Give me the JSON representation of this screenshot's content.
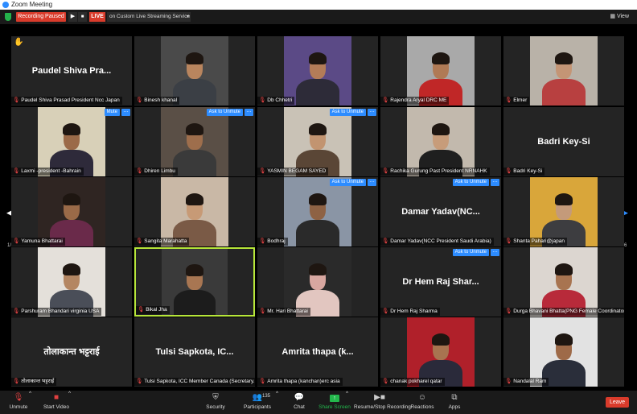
{
  "window": {
    "title": "Zoom Meeting"
  },
  "topbar": {
    "recording_status": "Recording Paused",
    "resume_icon": "▶",
    "stop_icon": "■",
    "live_badge": "LIVE",
    "live_service": "on Custom Live Streaming Service",
    "view_label": "View"
  },
  "gallery": {
    "page_prev_label": "1/6",
    "page_next_label": "1/6",
    "tiles": [
      {
        "name": "Paudel Shiva Prasad President Ncc Japan",
        "big": "Paudel Shiva Pra...",
        "video": false,
        "hand": true
      },
      {
        "name": "Binesh khanal",
        "video": true,
        "bg": "#4a4a4a",
        "shirt": "#3b3f45",
        "skin": "#b9855e"
      },
      {
        "name": "Db Chhetri",
        "video": true,
        "bg": "#5b4a86",
        "shirt": "#2d2b38",
        "skin": "#b37c58"
      },
      {
        "name": "Rajendra Aryal DRC ME",
        "video": true,
        "bg": "#a9a9a9",
        "shirt": "#c02727",
        "skin": "#b07a55"
      },
      {
        "name": "Elmer",
        "video": true,
        "bg": "#b9b2a8",
        "shirt": "#b84040",
        "skin": "#c49575"
      },
      {
        "name": "Laxmi -president -Bahrain",
        "video": true,
        "bg": "#d8d0b8",
        "shirt": "#2e2a3a",
        "skin": "#9b6a48",
        "button": "Mute"
      },
      {
        "name": "Dhiren Limbu",
        "video": true,
        "bg": "#5a4f46",
        "shirt": "#3a3a3a",
        "skin": "#9e6e4c",
        "button": "Ask to Unmute"
      },
      {
        "name": "YASMIN BEGAM SAYED",
        "video": true,
        "bg": "#c9c2b6",
        "shirt": "#5a4636",
        "skin": "#c29470",
        "button": "Ask to Unmute"
      },
      {
        "name": "Rachika Gurung Past President NRNAHK",
        "video": true,
        "bg": "#c2b9ad",
        "shirt": "#1f1f1f",
        "skin": "#c79c7a"
      },
      {
        "name": "Badri Key-Si",
        "big": "Badri Key-Si",
        "video": false
      },
      {
        "name": "Yamuna Bhattarai",
        "video": true,
        "bg": "#2f2522",
        "shirt": "#6a2a4a",
        "skin": "#9a6a48"
      },
      {
        "name": "Sangita Marahatta",
        "video": true,
        "bg": "#c9b8a6",
        "shirt": "#7a5a46",
        "skin": "#c79a76"
      },
      {
        "name": "Bodhraj",
        "video": true,
        "bg": "#8a95a5",
        "shirt": "#2a2a2a",
        "skin": "#8e6244",
        "button": "Ask to Unmute"
      },
      {
        "name": "Damar Yadav(NCC President Saudi Arabia)",
        "big": "Damar Yadav(NC...",
        "video": false,
        "button": "Ask to Unmute"
      },
      {
        "name": "Shanta Pahari@japan",
        "video": true,
        "bg": "#d9a63a",
        "shirt": "#3d3d40",
        "skin": "#c49a7a"
      },
      {
        "name": "Parshuram Bhandari virginia USA",
        "video": true,
        "bg": "#e4e0da",
        "shirt": "#4a4e58",
        "skin": "#b48662"
      },
      {
        "name": "Bikal Jha",
        "video": true,
        "bg": "#3a3a3a",
        "shirt": "#1c1c1c",
        "skin": "#a87652",
        "active": true
      },
      {
        "name": "Mr. Hari Bhattarai",
        "video": true,
        "bg": "#2a2a2a",
        "shirt": "#e2c6c0",
        "skin": "#d8a7a0"
      },
      {
        "name": "Dr Hem Raj Sharma",
        "big": "Dr Hem Raj Shar...",
        "video": false,
        "button": "Ask to Unmute"
      },
      {
        "name": "Durga Bhavani Bhatta(PNG Female Coordinator)",
        "video": true,
        "bg": "#dcd6d0",
        "shirt": "#b82a3a",
        "skin": "#a87450"
      },
      {
        "name": "तोलाकान्त भट्टराई",
        "big": "तोलाकान्त भट्टराई",
        "video": false
      },
      {
        "name": "Tulsi Sapkota, ICC Member Canada (Secretary...",
        "big": "Tulsi Sapkota, IC...",
        "video": false
      },
      {
        "name": "Amrita thapa (kanchan)erc asia",
        "big": "Amrita thapa (k...",
        "video": false
      },
      {
        "name": "chanak pokharel qatar",
        "video": true,
        "bg": "#b0202a",
        "shirt": "#2a2a3a",
        "skin": "#a87450"
      },
      {
        "name": "Nandalal Ram",
        "video": true,
        "bg": "#e2e2e2",
        "shirt": "#2a2e3a",
        "skin": "#9e6a48"
      }
    ]
  },
  "toolbar": {
    "unmute": "Unmute",
    "start_video": "Start Video",
    "security": "Security",
    "participants": "Participants",
    "participants_count": "135",
    "chat": "Chat",
    "share_screen": "Share Screen",
    "record": "Resume/Stop Recording",
    "reactions": "Reactions",
    "apps": "Apps",
    "leave": "Leave"
  }
}
